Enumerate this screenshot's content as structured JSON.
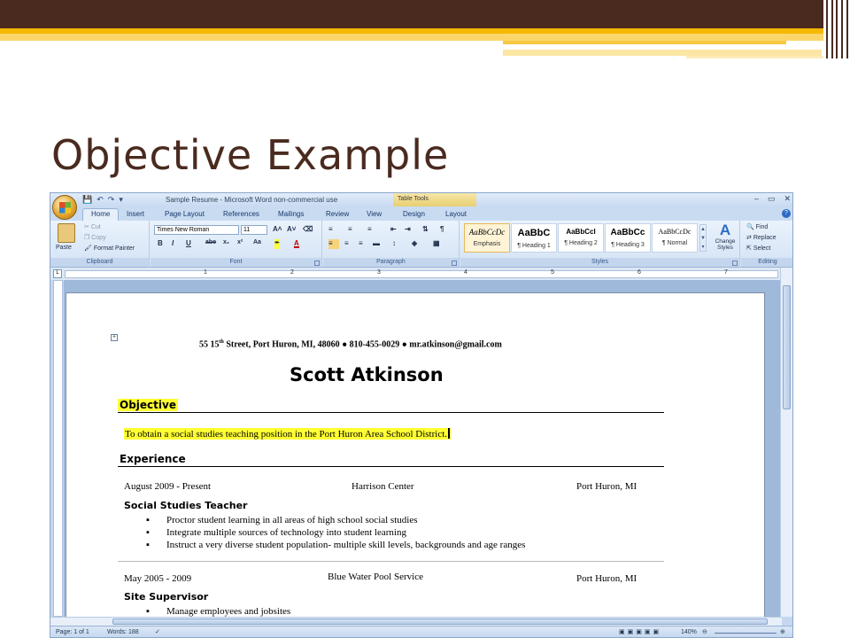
{
  "slide": {
    "title": "Objective Example"
  },
  "word": {
    "window_title": "Sample Resume - Microsoft Word non-commercial use",
    "context_tab": "Table Tools",
    "win_controls": [
      "–",
      "▭",
      "✕"
    ],
    "tabs": [
      "Home",
      "Insert",
      "Page Layout",
      "References",
      "Mailings",
      "Review",
      "View",
      "Design",
      "Layout"
    ],
    "ribbon": {
      "clipboard": {
        "paste": "Paste",
        "cut": "Cut",
        "copy": "Copy",
        "format_painter": "Format Painter",
        "label": "Clipboard"
      },
      "font": {
        "family": "Times New Roman",
        "size": "11",
        "label": "Font"
      },
      "paragraph": {
        "label": "Paragraph"
      },
      "styles": {
        "label": "Styles",
        "tiles": [
          {
            "preview": "AaBbCcDc",
            "name": "Emphasis"
          },
          {
            "preview": "AaBbC",
            "name": "¶ Heading 1"
          },
          {
            "preview": "AaBbCcI",
            "name": "¶ Heading 2"
          },
          {
            "preview": "AaBbCc",
            "name": "¶ Heading 3"
          },
          {
            "preview": "AaBbCcDc",
            "name": "¶ Normal"
          }
        ],
        "change_styles": "Change Styles"
      },
      "editing": {
        "find": "Find",
        "replace": "Replace",
        "select": "Select",
        "label": "Editing"
      }
    },
    "ruler_numbers": [
      "1",
      "2",
      "3",
      "4",
      "5",
      "6",
      "7"
    ],
    "status": {
      "page": "Page: 1 of 1",
      "words": "Words: 188",
      "zoom": "140%"
    }
  },
  "resume": {
    "address_pre": "55 15",
    "address_sup": "th",
    "address_post": " Street, Port Huron, MI, 48060 ● 810-455-0029 ● mr.atkinson@gmail.com",
    "name": "Scott Atkinson",
    "objective_heading": "Objective",
    "objective_text": "To obtain a social studies teaching position in the Port Huron Area School District.",
    "experience_heading": "Experience",
    "jobs": [
      {
        "dates": "August 2009 - Present",
        "employer": "Harrison Center",
        "location": "Port Huron, MI",
        "title": "Social Studies Teacher",
        "bullets": [
          "Proctor student learning in all areas of high school social studies",
          "Integrate multiple sources of technology into student learning",
          "Instruct a very diverse student population- multiple skill levels, backgrounds and age ranges"
        ]
      },
      {
        "dates": "May 2005 - 2009",
        "employer": "Blue Water Pool Service",
        "location": "Port Huron, MI",
        "title": "Site Supervisor",
        "bullets": [
          "Manage employees and jobsites"
        ]
      }
    ]
  }
}
